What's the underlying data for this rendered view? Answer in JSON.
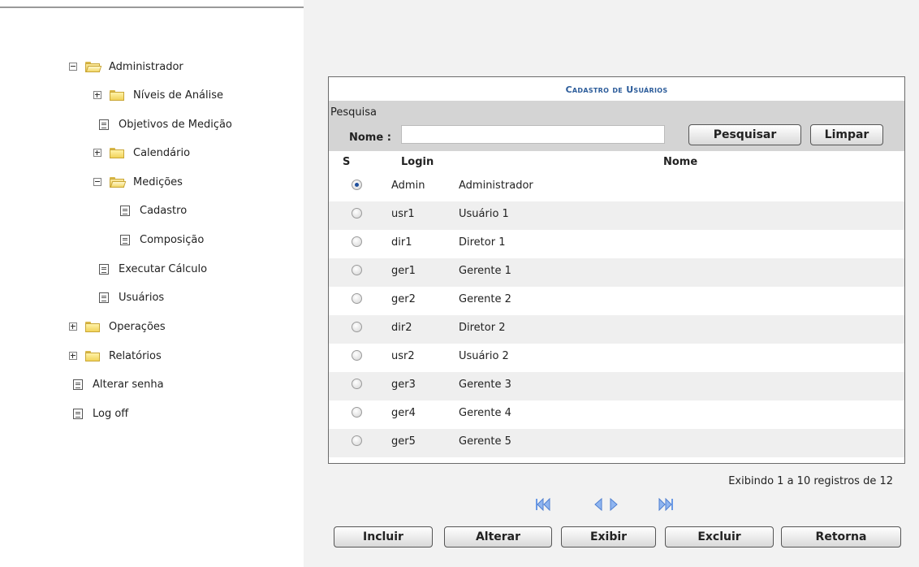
{
  "tree": {
    "administrador": "Administrador",
    "niveis": "Níveis de Análise",
    "objetivos": "Objetivos de Medição",
    "calendario": "Calendário",
    "medicoes": "Medições",
    "cadastro": "Cadastro",
    "composicao": "Composição",
    "executar": "Executar Cálculo",
    "usuarios": "Usuários",
    "operacoes": "Operações",
    "relatorios": "Relatórios",
    "alterar_senha": "Alterar senha",
    "logoff": "Log off"
  },
  "panel": {
    "title": "Cadastro de Usuários",
    "search_label": "Pesquisa",
    "name_label": "Nome :",
    "name_value": "",
    "search_button": "Pesquisar",
    "clear_button": "Limpar"
  },
  "table": {
    "headers": {
      "select": "S",
      "login": "Login",
      "name": "Nome"
    },
    "rows": [
      {
        "login": "Admin",
        "name": "Administrador",
        "selected": true
      },
      {
        "login": "usr1",
        "name": "Usuário 1",
        "selected": false
      },
      {
        "login": "dir1",
        "name": "Diretor 1",
        "selected": false
      },
      {
        "login": "ger1",
        "name": "Gerente 1",
        "selected": false
      },
      {
        "login": "ger2",
        "name": "Gerente 2",
        "selected": false
      },
      {
        "login": "dir2",
        "name": "Diretor 2",
        "selected": false
      },
      {
        "login": "usr2",
        "name": "Usuário 2",
        "selected": false
      },
      {
        "login": "ger3",
        "name": "Gerente 3",
        "selected": false
      },
      {
        "login": "ger4",
        "name": "Gerente 4",
        "selected": false
      },
      {
        "login": "ger5",
        "name": "Gerente 5",
        "selected": false
      }
    ]
  },
  "pagination": {
    "summary": "Exibindo 1 a 10 registros de 12",
    "first_icon": "first-page-icon",
    "prev_icon": "previous-page-icon",
    "next_icon": "next-page-icon",
    "last_icon": "last-page-icon"
  },
  "actions": {
    "incluir": "Incluir",
    "alterar": "Alterar",
    "exibir": "Exibir",
    "excluir": "Excluir",
    "retorna": "Retorna"
  },
  "colors": {
    "title_blue": "#2c5c9a",
    "nav_blue": "#6a9ae6",
    "folder_yellow": "#f1d35a"
  }
}
